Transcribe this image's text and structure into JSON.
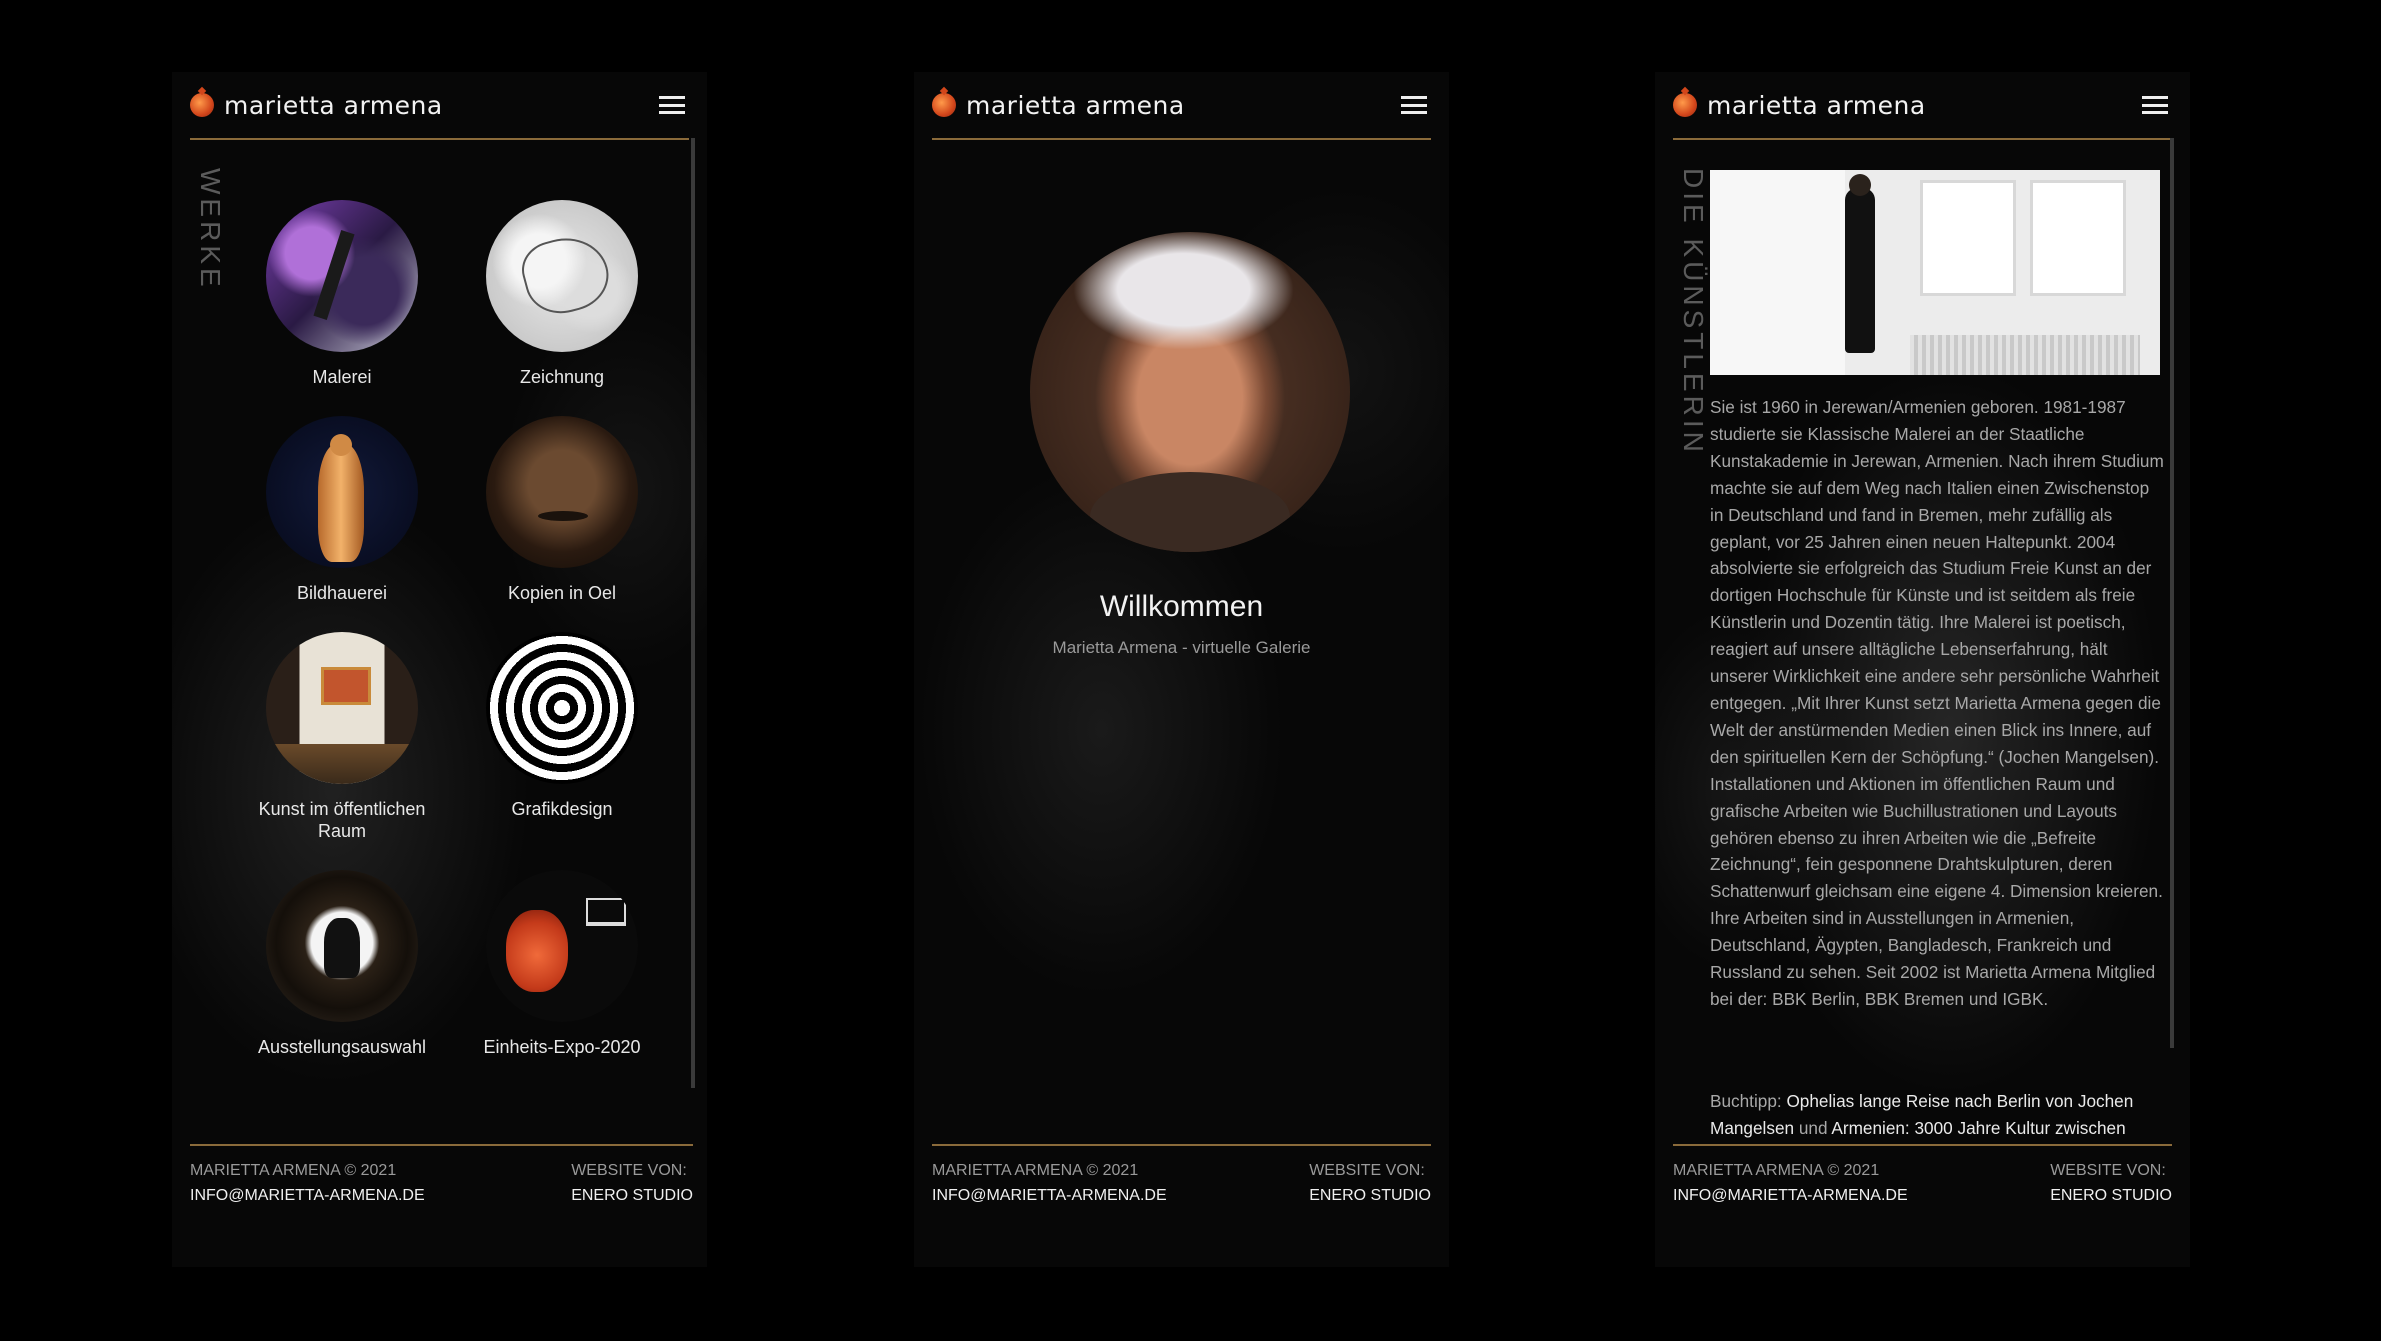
{
  "brand": {
    "name": "marietta armena"
  },
  "werke": {
    "side_label": "WERKE",
    "tiles": [
      {
        "label": "Malerei"
      },
      {
        "label": "Zeichnung"
      },
      {
        "label": "Bildhauerei"
      },
      {
        "label": "Kopien in Oel"
      },
      {
        "label": "Kunst im öffentlichen Raum"
      },
      {
        "label": "Grafikdesign"
      },
      {
        "label": "Ausstellungsauswahl"
      },
      {
        "label": "Einheits-Expo-2020"
      }
    ]
  },
  "welcome": {
    "title": "Willkommen",
    "subtitle": "Marietta Armena - virtuelle Galerie"
  },
  "artist": {
    "side_label": "DIE KÜNSTLERIN",
    "bio": "Sie ist 1960 in Jerewan/Armenien geboren. 1981-1987 studierte sie Klassische Malerei an der Staatliche Kunstakademie in Jerewan, Armenien. Nach ihrem Studium machte sie auf dem Weg nach Italien einen Zwischenstop in Deutschland und fand in Bremen, mehr zufällig als geplant, vor 25 Jahren einen neuen Haltepunkt. 2004 absolvierte sie erfolgreich das Studium Freie Kunst an der dortigen Hochschule für Künste und ist seitdem als freie Künstlerin und Dozentin tätig. Ihre Malerei ist poetisch, reagiert auf unsere alltägliche Lebenserfahrung, hält unserer Wirklichkeit eine andere sehr persönliche Wahrheit entgegen. „Mit Ihrer Kunst setzt Marietta Armena gegen die Welt der anstürmenden Medien einen Blick ins Innere, auf den spirituellen Kern der Schöpfung.“ (Jochen Mangelsen). Installationen und Aktionen im öffentlichen Raum und grafische Arbeiten wie Buchillustrationen und Layouts gehören ebenso zu ihren Arbeiten wie die „Befreite Zeichnung“, fein gesponnene Drahtskulpturen, deren Schattenwurf gleichsam eine eigene 4. Dimension kreieren. Ihre Arbeiten sind in Ausstellungen in Armenien, Deutschland, Ägypten, Bangladesch, Frankreich und Russland zu sehen. Seit 2002 ist Marietta Armena Mitglied bei der: BBK Berlin, BBK Bremen und IGBK.",
    "tip_prefix": "Buchtipp: ",
    "tip_link1": "Ophelias lange Reise nach Berlin von Jochen Mangelsen",
    "tip_and": " und ",
    "tip_link2": "Armenien: 3000 Jahre Kultur zwischen"
  },
  "footer": {
    "copyright": "MARIETTA ARMENA © 2021",
    "email": "INFO@MARIETTA-ARMENA.DE",
    "website_by": "WEBSITE VON:",
    "studio": "ENERO STUDIO"
  }
}
